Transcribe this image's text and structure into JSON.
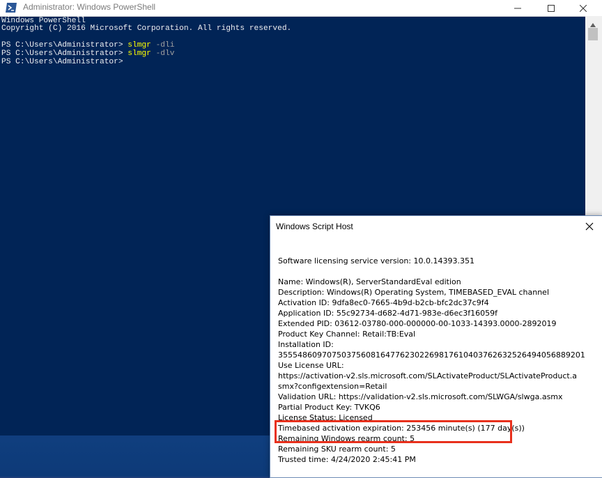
{
  "powershell": {
    "title": "Administrator: Windows PowerShell",
    "lines": [
      {
        "text": "Windows PowerShell"
      },
      {
        "text": "Copyright (C) 2016 Microsoft Corporation. All rights reserved."
      },
      {
        "text": ""
      },
      {
        "prompt": "PS C:\\Users\\Administrator> ",
        "cmd": "slmgr",
        "arg": " -dli"
      },
      {
        "prompt": "PS C:\\Users\\Administrator> ",
        "cmd": "slmgr",
        "arg": " -dlv"
      },
      {
        "prompt": "PS C:\\Users\\Administrator>",
        "cmd": "",
        "arg": ""
      }
    ],
    "colors": {
      "background": "#012456",
      "text": "#eeedf0",
      "command": "#ffff00"
    }
  },
  "dialog": {
    "title": "Windows Script Host",
    "service_version": "Software licensing service version: 10.0.14393.351",
    "name": "Name: Windows(R), ServerStandardEval edition",
    "description": "Description: Windows(R) Operating System, TIMEBASED_EVAL channel",
    "activation_id": "Activation ID: 9dfa8ec0-7665-4b9d-b2cb-bfc2dc37c9f4",
    "application_id": "Application ID: 55c92734-d682-4d71-983e-d6ec3f16059f",
    "extended_pid": "Extended PID: 03612-03780-000-000000-00-1033-14393.0000-2892019",
    "product_key_channel": "Product Key Channel: Retail:TB:Eval",
    "installation_id_label": "Installation ID:",
    "installation_id": "355548609707503756081647762302269817610403762632526494056889201",
    "use_license_url_label": "Use License URL:",
    "use_license_url": "https://activation-v2.sls.microsoft.com/SLActivateProduct/SLActivateProduct.asmx?configextension=Retail",
    "validation_url": "Validation URL: https://validation-v2.sls.microsoft.com/SLWGA/slwga.asmx",
    "partial_product_key": "Partial Product Key: TVKQ6",
    "license_status": "License Status: Licensed",
    "timebased_expiration": "Timebased activation expiration: 253456 minute(s) (177 day(s))",
    "windows_rearm": "Remaining Windows rearm count: 5",
    "sku_rearm": "Remaining SKU rearm count: 5",
    "trusted_time": "Trusted time: 4/24/2020 2:45:41 PM",
    "highlight_color": "#e8301c"
  }
}
